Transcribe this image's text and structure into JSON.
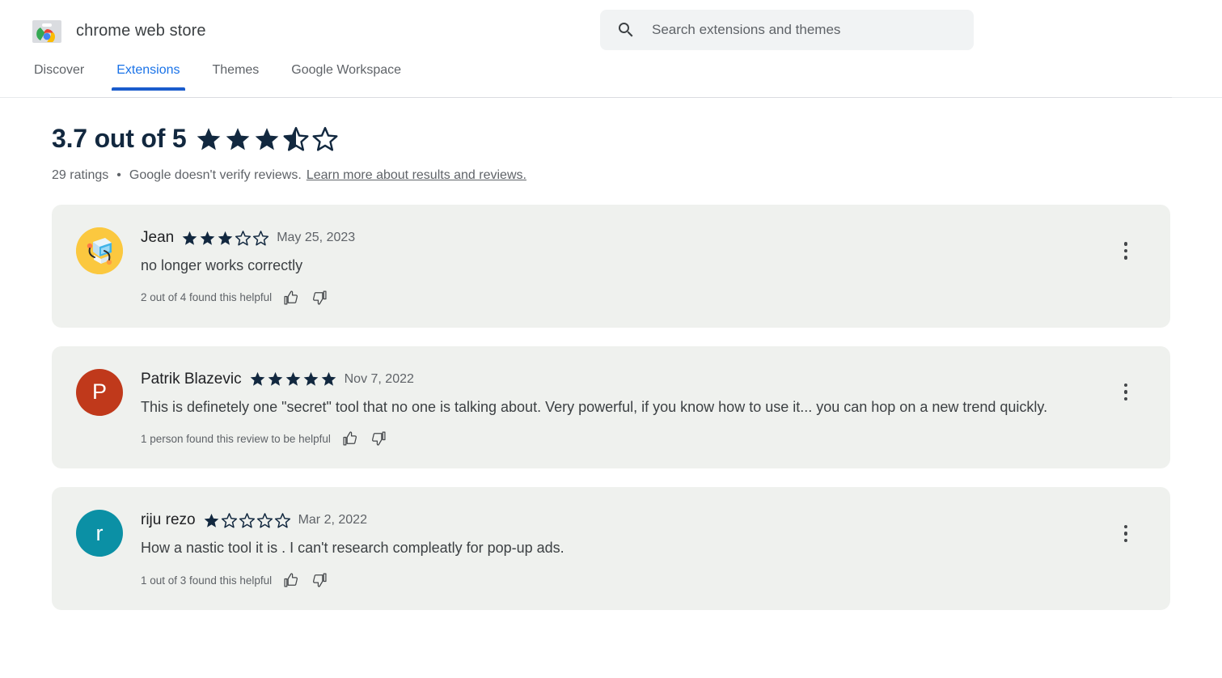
{
  "header": {
    "brand_name": "chrome web store",
    "logo_icon": "chrome-web-store-logo",
    "search": {
      "icon": "search-icon",
      "placeholder": "Search extensions and themes",
      "value": ""
    },
    "tabs": [
      {
        "label": "Discover",
        "active": false
      },
      {
        "label": "Extensions",
        "active": true
      },
      {
        "label": "Themes",
        "active": false
      },
      {
        "label": "Google Workspace",
        "active": false
      }
    ]
  },
  "ratings_summary": {
    "headline": "3.7 out of 5",
    "score": 3.7,
    "max": 5,
    "stars_full": 3,
    "stars_half": 1,
    "stars_empty": 1,
    "star_color": "#12283f",
    "count_text": "29 ratings",
    "separator": "•",
    "disclaimer": "Google doesn't verify reviews.",
    "learn_more_label": "Learn more about results and reviews."
  },
  "reviews": [
    {
      "author": "Jean",
      "avatar_type": "image",
      "avatar_icon": "isometric-computer-avatar",
      "avatar_bg": "#fbc83f",
      "avatar_initial": "",
      "rating": 3,
      "date": "May 25, 2023",
      "text": "no longer works correctly",
      "helpful_text": "2 out of 4 found this helpful",
      "thumbs_up_icon": "thumb-up-icon",
      "thumbs_down_icon": "thumb-down-icon",
      "overflow_icon": "more-vert-icon"
    },
    {
      "author": "Patrik Blazevic",
      "avatar_type": "initial",
      "avatar_icon": "",
      "avatar_bg": "#c0391b",
      "avatar_initial": "P",
      "rating": 5,
      "date": "Nov 7, 2022",
      "text": "This is definetely one \"secret\" tool that no one is talking about. Very powerful, if you know how to use it... you can hop on a new trend quickly.",
      "helpful_text": "1 person found this review to be helpful",
      "thumbs_up_icon": "thumb-up-icon",
      "thumbs_down_icon": "thumb-down-icon",
      "overflow_icon": "more-vert-icon"
    },
    {
      "author": "riju rezo",
      "avatar_type": "initial",
      "avatar_icon": "",
      "avatar_bg": "#0b90a5",
      "avatar_initial": "r",
      "rating": 1,
      "date": "Mar 2, 2022",
      "text": "How a nastic tool it is . I can't research compleatly for pop-up ads.",
      "helpful_text": "1 out of 3 found this helpful",
      "thumbs_up_icon": "thumb-up-icon",
      "thumbs_down_icon": "thumb-down-icon",
      "overflow_icon": "more-vert-icon"
    }
  ],
  "colors": {
    "accent_blue": "#1a73e8",
    "tab_underline": "#1a5ccc",
    "card_bg": "#eff1ee",
    "star_navy": "#12283f",
    "text_primary": "#202124",
    "text_secondary": "#5f6368"
  }
}
